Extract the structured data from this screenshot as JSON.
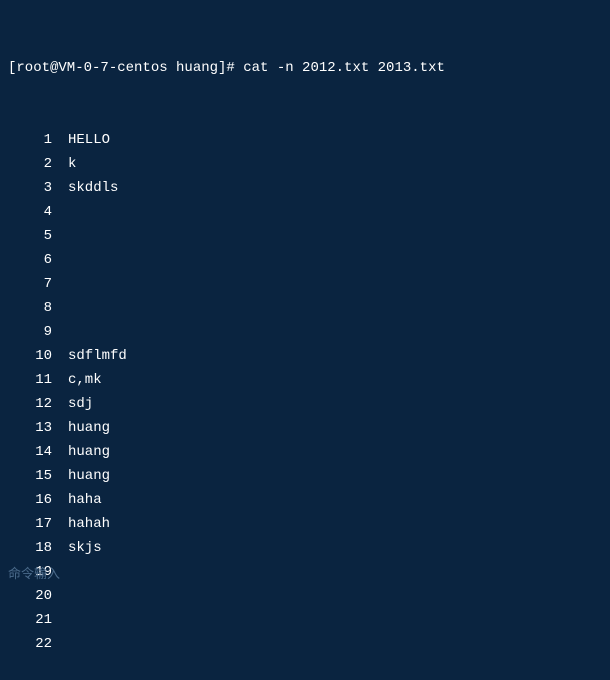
{
  "prompt": {
    "text": "[root@VM-0-7-centos huang]# cat -n 2012.txt 2013.txt"
  },
  "output": [
    {
      "num": "1",
      "content": "HELLO"
    },
    {
      "num": "2",
      "content": "k"
    },
    {
      "num": "3",
      "content": "skddls"
    },
    {
      "num": "4",
      "content": ""
    },
    {
      "num": "5",
      "content": ""
    },
    {
      "num": "6",
      "content": ""
    },
    {
      "num": "7",
      "content": ""
    },
    {
      "num": "8",
      "content": ""
    },
    {
      "num": "9",
      "content": ""
    },
    {
      "num": "10",
      "content": "sdflmfd"
    },
    {
      "num": "11",
      "content": "c,mk"
    },
    {
      "num": "12",
      "content": "sdj"
    },
    {
      "num": "13",
      "content": "huang"
    },
    {
      "num": "14",
      "content": "huang"
    },
    {
      "num": "15",
      "content": "huang"
    },
    {
      "num": "16",
      "content": "haha"
    },
    {
      "num": "17",
      "content": "hahah"
    },
    {
      "num": "18",
      "content": "skjs"
    },
    {
      "num": "19",
      "content": ""
    },
    {
      "num": "20",
      "content": ""
    },
    {
      "num": "21",
      "content": ""
    },
    {
      "num": "22",
      "content": ""
    }
  ],
  "input_hint": "命令输入"
}
